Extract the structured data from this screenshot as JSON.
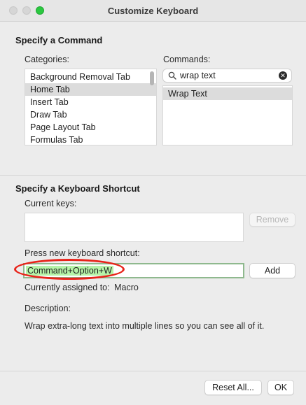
{
  "window": {
    "title": "Customize Keyboard",
    "zoom_button_color": "#2bc840"
  },
  "command_section": {
    "title": "Specify a Command",
    "categories_label": "Categories:",
    "commands_label": "Commands:",
    "categories": [
      "Background Removal Tab",
      "Home Tab",
      "Insert Tab",
      "Draw Tab",
      "Page Layout Tab",
      "Formulas Tab"
    ],
    "selected_category": "Home Tab",
    "search": {
      "value": "wrap text",
      "icon": "magnifier-icon",
      "clear_icon": "clear-icon"
    },
    "commands": [
      "Wrap Text"
    ],
    "selected_command": "Wrap Text"
  },
  "shortcut_section": {
    "title": "Specify a Keyboard Shortcut",
    "current_keys_label": "Current keys:",
    "current_keys": [],
    "remove_label": "Remove",
    "press_new_label": "Press new keyboard shortcut:",
    "new_shortcut_value": "Command+Option+W",
    "add_label": "Add",
    "assigned_label": "Currently assigned to:",
    "assigned_value": "Macro",
    "description_label": "Description:",
    "description_text": "Wrap extra-long text into multiple lines so you can see all of it.",
    "highlight_color": "#e8231a"
  },
  "footer": {
    "reset_label": "Reset All...",
    "ok_label": "OK"
  }
}
